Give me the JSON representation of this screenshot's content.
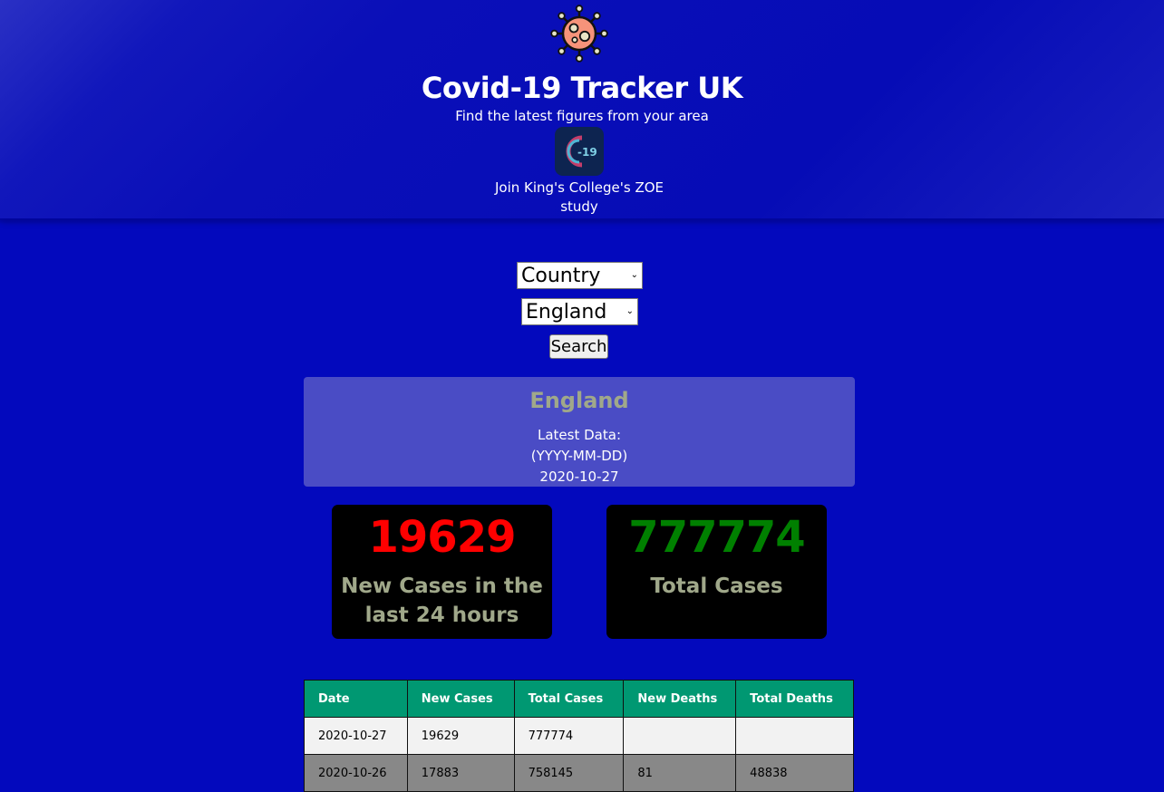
{
  "header": {
    "title": "Covid-19 Tracker UK",
    "subtitle": "Find the latest figures from your area",
    "zoe_logo_text": "-19",
    "zoe_link": "Join King's College's ZOE study"
  },
  "search": {
    "area_type": "Country",
    "region": "England",
    "button_label": "Search"
  },
  "region_card": {
    "name": "England",
    "latest_label": "Latest Data:",
    "date_format": "(YYYY-MM-DD)",
    "latest_date": "2020-10-27"
  },
  "stats": {
    "new_cases": "19629",
    "new_cases_label": "New Cases in the last 24 hours",
    "total_cases": "777774",
    "total_cases_label": "Total Cases"
  },
  "table": {
    "headers": [
      "Date",
      "New Cases",
      "Total Cases",
      "New Deaths",
      "Total Deaths"
    ],
    "rows": [
      [
        "2020-10-27",
        "19629",
        "777774",
        "",
        ""
      ],
      [
        "2020-10-26",
        "17883",
        "758145",
        "81",
        "48838"
      ]
    ]
  },
  "colors": {
    "background": "#0309bd",
    "new_cases": "#ff0000",
    "total_cases": "#008000",
    "table_header": "#009872",
    "card_label": "#a0a88a"
  },
  "icons": {
    "logo": "virus-icon",
    "zoe": "zoe-covid-study-logo",
    "select_arrow": "chevron-down-icon"
  }
}
